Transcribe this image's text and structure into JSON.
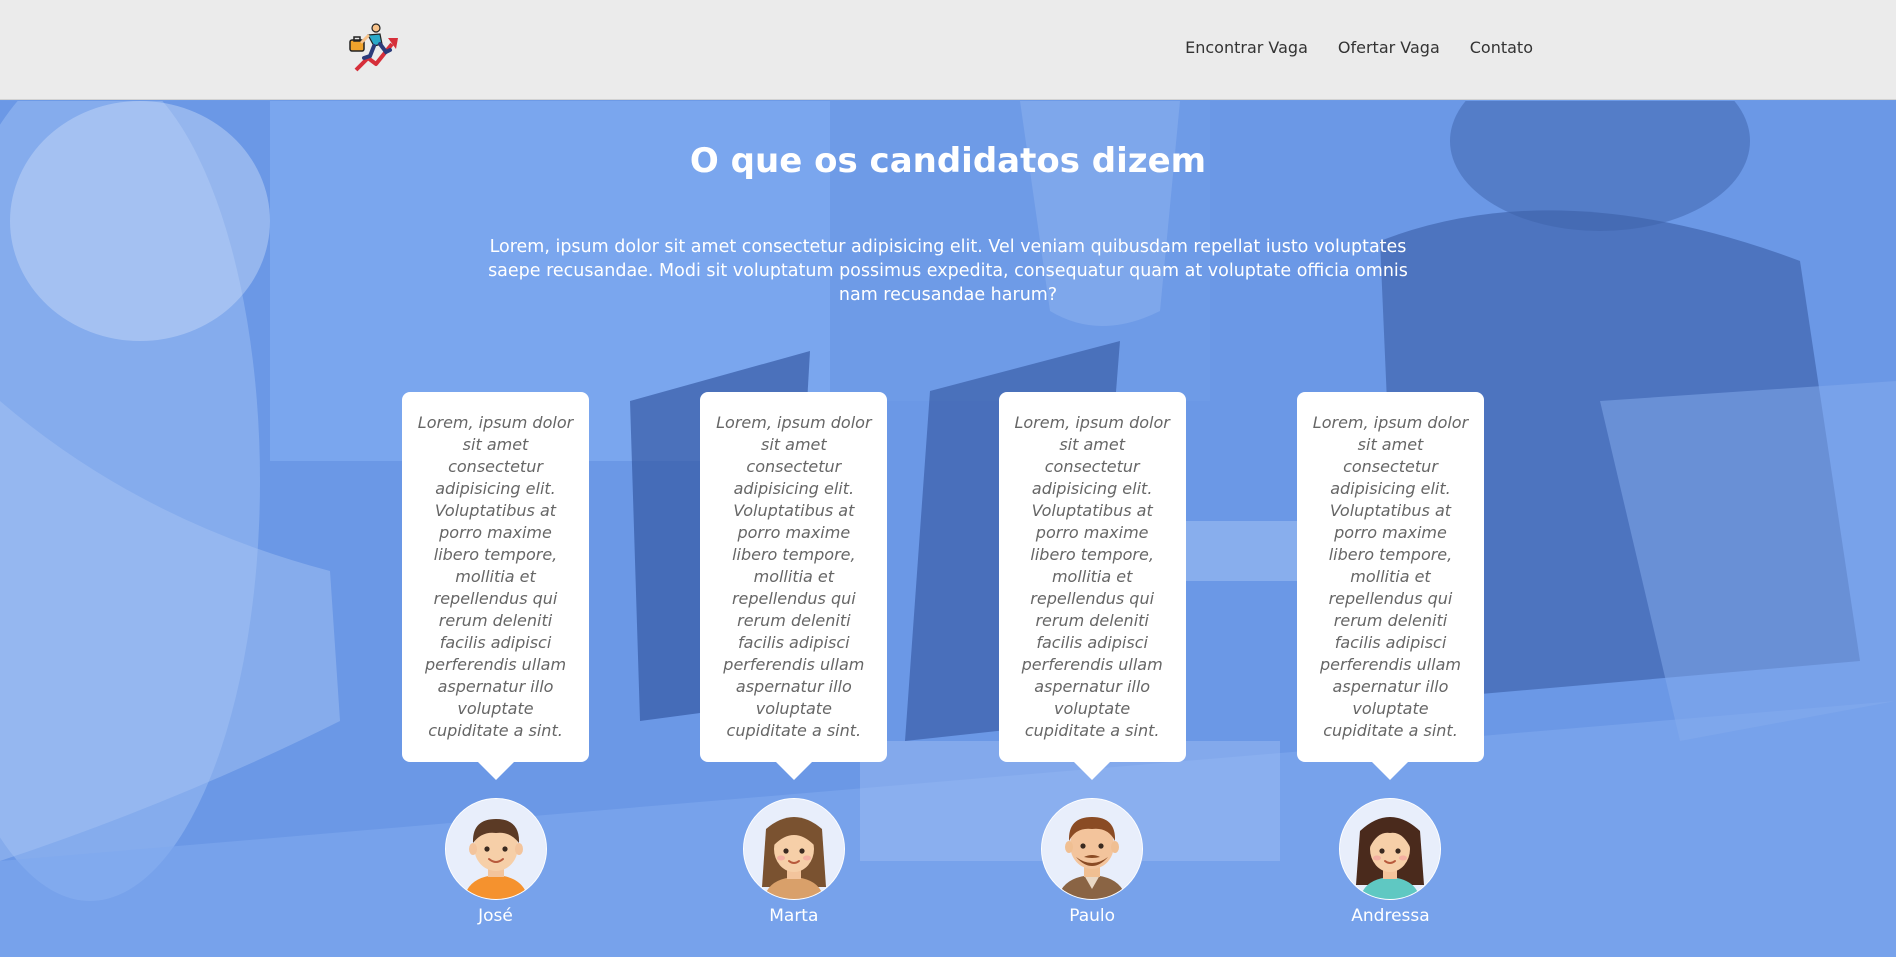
{
  "header": {
    "logo_icon": "runner-chart-logo-icon",
    "nav": [
      {
        "label": "Encontrar Vaga"
      },
      {
        "label": "Ofertar Vaga"
      },
      {
        "label": "Contato"
      }
    ]
  },
  "section": {
    "title": "O que os candidatos dizem",
    "intro": "Lorem, ipsum dolor sit amet consectetur adipisicing elit. Vel veniam quibusdam repellat iusto voluptates saepe recusandae. Modi sit voluptatum possimus expedita, consequatur quam at voluptate officia omnis nam recusandae harum?"
  },
  "testimonials": [
    {
      "quote": "Lorem, ipsum dolor sit amet consectetur adipisicing elit. Voluptatibus at porro maxime libero tempore, mollitia et repellendus qui rerum deleniti facilis adipisci perferendis ullam aspernatur illo voluptate cupiditate a sint.",
      "name": "José",
      "avatar_icon": "boy-avatar-icon"
    },
    {
      "quote": "Lorem, ipsum dolor sit amet consectetur adipisicing elit. Voluptatibus at porro maxime libero tempore, mollitia et repellendus qui rerum deleniti facilis adipisci perferendis ullam aspernatur illo voluptate cupiditate a sint.",
      "name": "Marta",
      "avatar_icon": "woman-avatar-icon"
    },
    {
      "quote": "Lorem, ipsum dolor sit amet consectetur adipisicing elit. Voluptatibus at porro maxime libero tempore, mollitia et repellendus qui rerum deleniti facilis adipisci perferendis ullam aspernatur illo voluptate cupiditate a sint.",
      "name": "Paulo",
      "avatar_icon": "bearded-man-avatar-icon"
    },
    {
      "quote": "Lorem, ipsum dolor sit amet consectetur adipisicing elit. Voluptatibus at porro maxime libero tempore, mollitia et repellendus qui rerum deleniti facilis adipisci perferendis ullam aspernatur illo voluptate cupiditate a sint.",
      "name": "Andressa",
      "avatar_icon": "girl-avatar-icon"
    }
  ],
  "colors": {
    "header_bg": "#ebebeb",
    "hero_tint": "#6d9ae6",
    "card_bg": "#ffffff",
    "quote_text": "#666666"
  }
}
